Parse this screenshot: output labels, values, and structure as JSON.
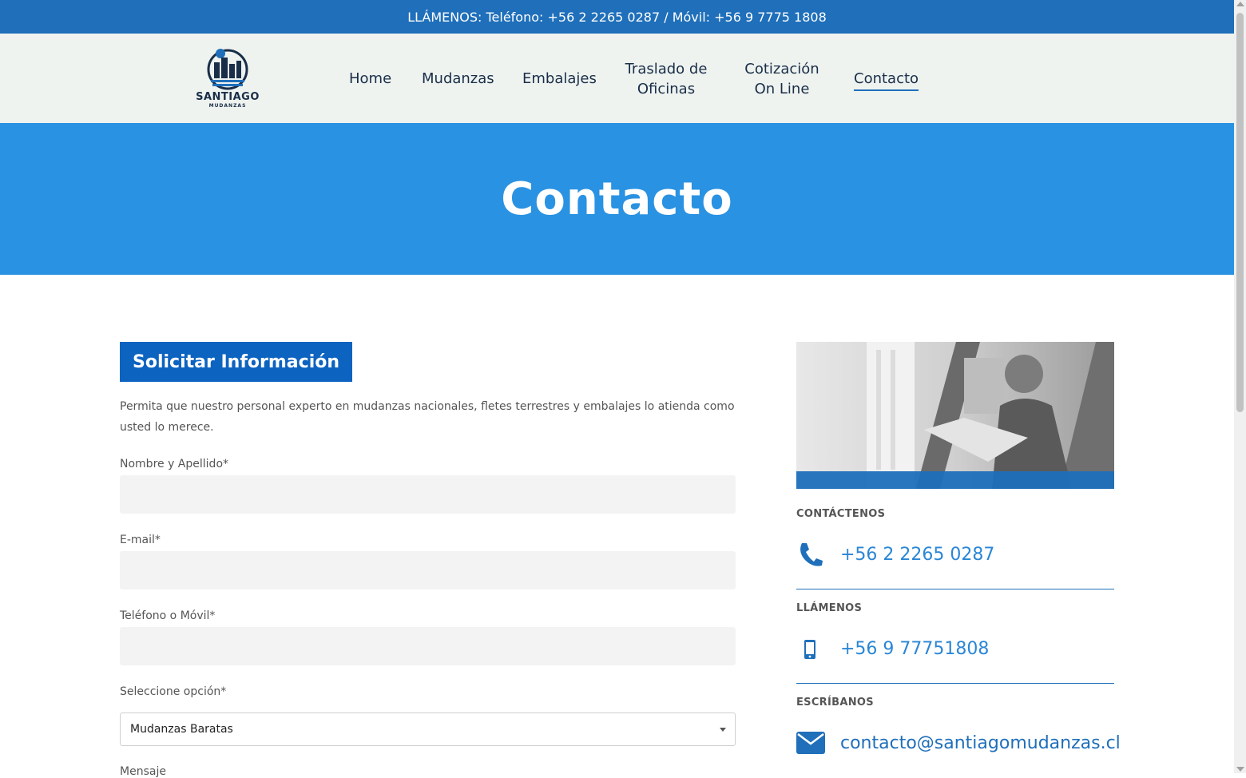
{
  "topbar": {
    "text": "LLÁMENOS: Teléfono: +56 2 2265 0287 / Móvil: +56 9 7775 1808"
  },
  "logo": {
    "brand": "SANTIAGO",
    "sub": "MUDANZAS"
  },
  "nav": [
    {
      "label": "Home"
    },
    {
      "label": "Mudanzas"
    },
    {
      "label": "Embalajes"
    },
    {
      "label": "Traslado de Oficinas"
    },
    {
      "label": "Cotización On Line"
    },
    {
      "label": "Contacto",
      "active": true
    }
  ],
  "hero": {
    "title": "Contacto"
  },
  "form": {
    "title": "Solicitar Información",
    "intro": "Permita que nuestro personal experto en mudanzas nacionales, fletes terrestres y embalajes lo atienda como usted lo merece.",
    "fields": [
      {
        "label": "Nombre y Apellido*",
        "value": ""
      },
      {
        "label": "E-mail*",
        "value": ""
      },
      {
        "label": "Teléfono o Móvil*",
        "value": ""
      }
    ],
    "select_label": "Seleccione opción*",
    "select_value": "Mudanzas Baratas",
    "message_label": "Mensaje"
  },
  "contact": {
    "phone_label": "CONTÁCTENOS",
    "phone_value": "+56 2 2265 0287",
    "mobile_label": "LLÁMENOS",
    "mobile_value": "+56 9 77751808",
    "email_label": "ESCRÍBANOS",
    "email_value": "contacto@santiagomudanzas.cl"
  },
  "colors": {
    "topbar": "#1f6fba",
    "hero": "#2a92e2",
    "accent": "#0d63c0",
    "link": "#2a86d6"
  }
}
